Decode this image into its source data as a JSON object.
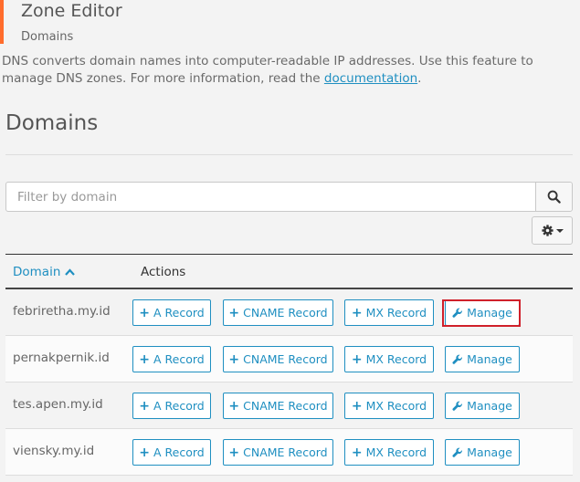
{
  "header": {
    "title": "Zone Editor",
    "subtitle": "Domains"
  },
  "description": {
    "text": "DNS converts domain names into computer-readable IP addresses. Use this feature to manage DNS zones. For more information, read the ",
    "link": "documentation",
    "tail": "."
  },
  "section": {
    "title": "Domains"
  },
  "search": {
    "placeholder": "Filter by domain",
    "value": "",
    "icon": "search-icon"
  },
  "settings": {
    "icon": "gear-icon"
  },
  "table": {
    "col_domain": "Domain",
    "col_actions": "Actions",
    "sort": "ascending",
    "rows": [
      {
        "domain": "febriretha.my.id"
      },
      {
        "domain": "pernakpernik.id"
      },
      {
        "domain": "tes.apen.my.id"
      },
      {
        "domain": "viensky.my.id"
      }
    ],
    "buttons": {
      "a_record": "A Record",
      "cname_record": "CNAME Record",
      "mx_record": "MX Record",
      "manage": "Manage"
    }
  },
  "colors": {
    "accent": "#1f8fc1",
    "header_bar": "#ff6c2c",
    "highlight": "#d0202a"
  }
}
